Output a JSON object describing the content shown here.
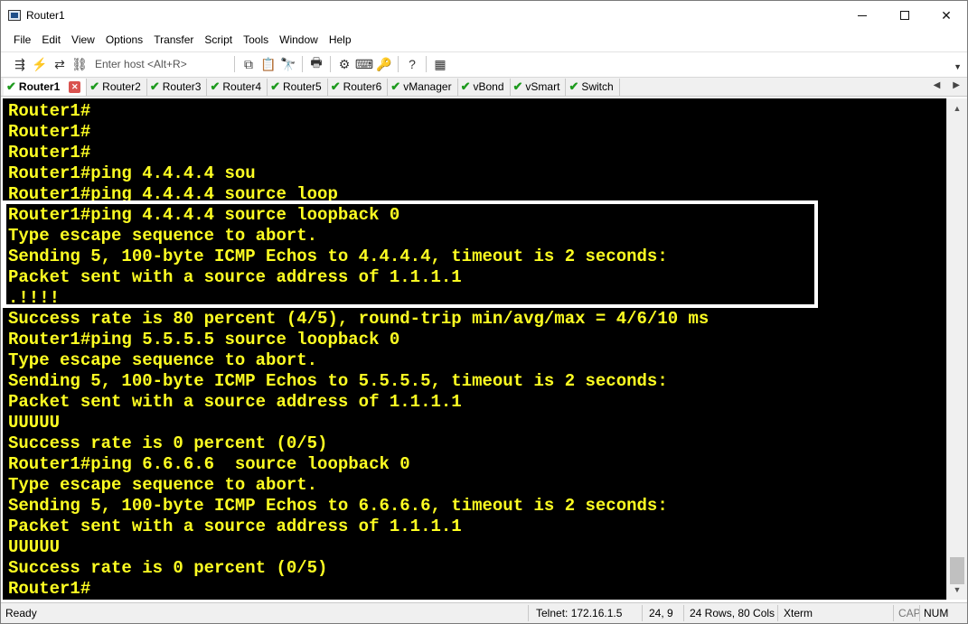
{
  "window": {
    "title": "Router1"
  },
  "menu": [
    "File",
    "Edit",
    "View",
    "Options",
    "Transfer",
    "Script",
    "Tools",
    "Window",
    "Help"
  ],
  "toolbar": {
    "host_placeholder": "Enter host <Alt+R>"
  },
  "tabs": [
    {
      "label": "Router1",
      "active": true
    },
    {
      "label": "Router2"
    },
    {
      "label": "Router3"
    },
    {
      "label": "Router4"
    },
    {
      "label": "Router5"
    },
    {
      "label": "Router6"
    },
    {
      "label": "vManager"
    },
    {
      "label": "vBond"
    },
    {
      "label": "vSmart"
    },
    {
      "label": "Switch"
    }
  ],
  "terminal": {
    "lines": [
      "Router1#",
      "Router1#",
      "Router1#",
      "Router1#ping 4.4.4.4 sou",
      "Router1#ping 4.4.4.4 source loop",
      "Router1#ping 4.4.4.4 source loopback 0",
      "Type escape sequence to abort.",
      "Sending 5, 100-byte ICMP Echos to 4.4.4.4, timeout is 2 seconds:",
      "Packet sent with a source address of 1.1.1.1",
      ".!!!!",
      "Success rate is 80 percent (4/5), round-trip min/avg/max = 4/6/10 ms",
      "Router1#ping 5.5.5.5 source loopback 0",
      "Type escape sequence to abort.",
      "Sending 5, 100-byte ICMP Echos to 5.5.5.5, timeout is 2 seconds:",
      "Packet sent with a source address of 1.1.1.1",
      "UUUUU",
      "Success rate is 0 percent (0/5)",
      "Router1#ping 6.6.6.6  source loopback 0",
      "Type escape sequence to abort.",
      "Sending 5, 100-byte ICMP Echos to 6.6.6.6, timeout is 2 seconds:",
      "Packet sent with a source address of 1.1.1.1",
      "UUUUU",
      "Success rate is 0 percent (0/5)",
      "Router1#"
    ],
    "text_color": "#ffff22",
    "background": "#000000",
    "highlight_color": "#ffffff"
  },
  "status": {
    "ready": "Ready",
    "connection": "Telnet: 172.16.1.5",
    "cursor_pos": "24,  9",
    "dimensions": "24 Rows, 80 Cols",
    "terminal_type": "Xterm",
    "cap": "CAP",
    "num": "NUM"
  }
}
